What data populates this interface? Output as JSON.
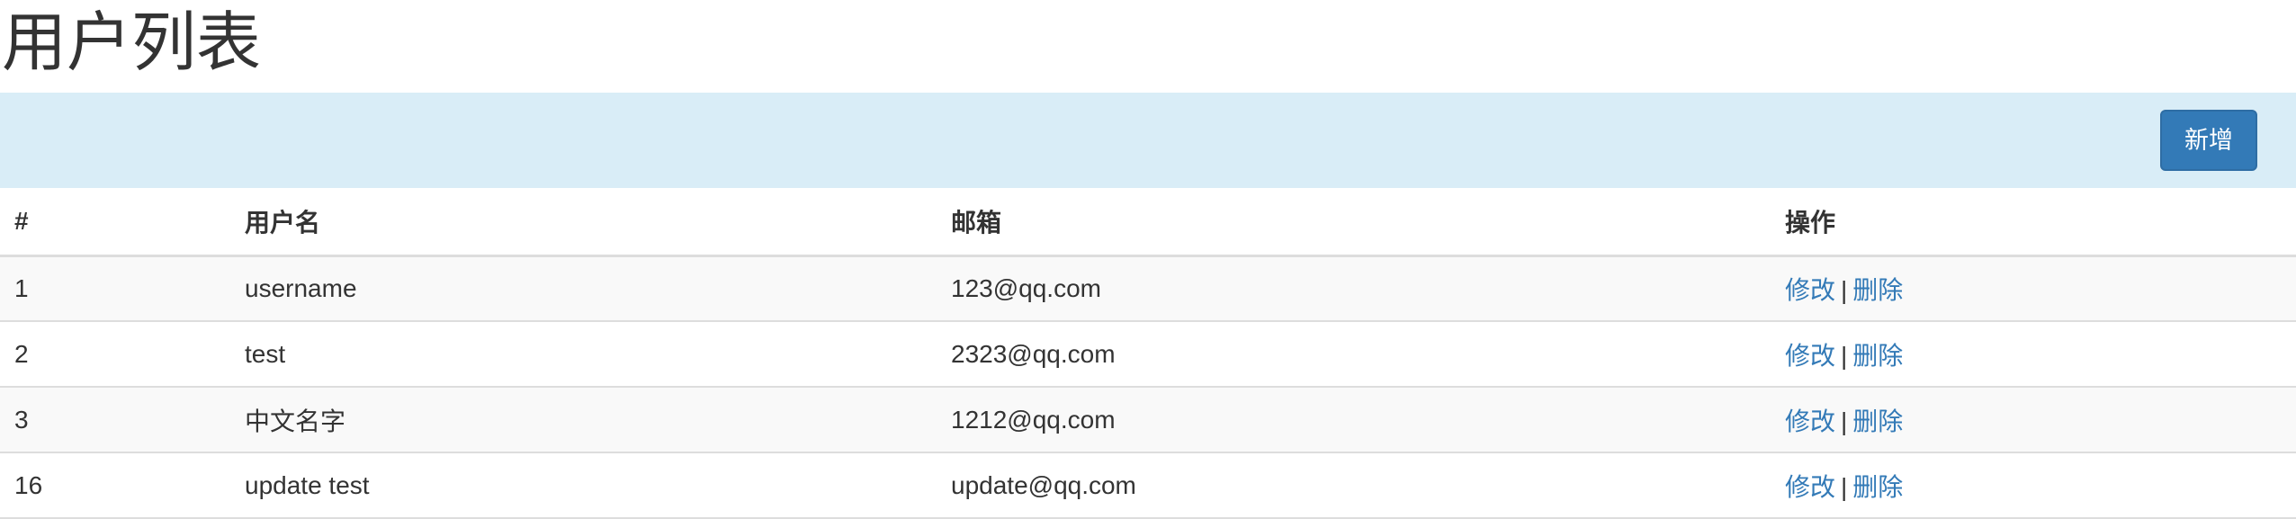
{
  "page": {
    "title": "用户列表"
  },
  "toolbar": {
    "add_label": "新增"
  },
  "table": {
    "columns": [
      "#",
      "用户名",
      "邮箱",
      "操作"
    ],
    "rows": [
      {
        "id": "1",
        "username": "username",
        "email": "123@qq.com",
        "edit": "修改",
        "sep": "|",
        "delete": "删除"
      },
      {
        "id": "2",
        "username": "test",
        "email": "2323@qq.com",
        "edit": "修改",
        "sep": "|",
        "delete": "删除"
      },
      {
        "id": "3",
        "username": "中文名字",
        "email": "1212@qq.com",
        "edit": "修改",
        "sep": "|",
        "delete": "删除"
      },
      {
        "id": "16",
        "username": "update test",
        "email": "update@qq.com",
        "edit": "修改",
        "sep": "|",
        "delete": "删除"
      }
    ]
  },
  "colors": {
    "toolbar_bg": "#d9edf7",
    "primary": "#337ab7",
    "text": "#333333",
    "stripe": "#f9f9f9",
    "border": "#dddddd"
  }
}
